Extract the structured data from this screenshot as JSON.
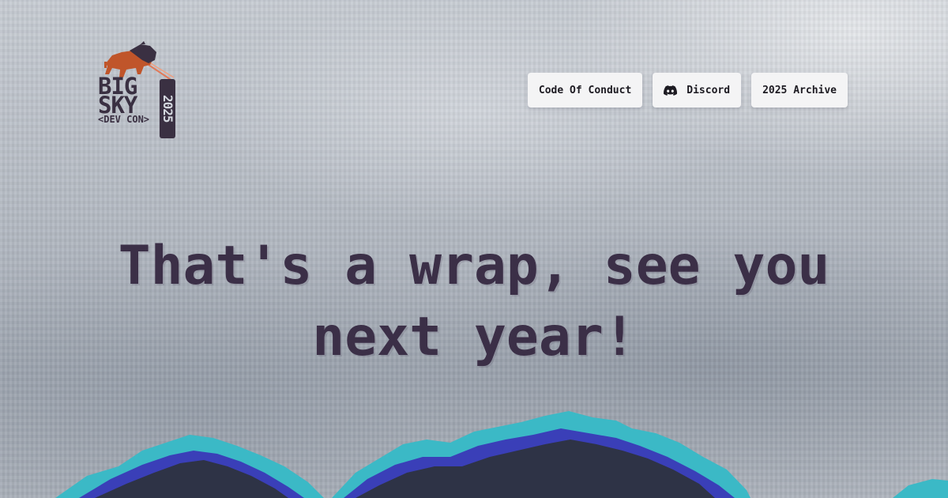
{
  "logo": {
    "line1": "BIG",
    "line2": "SKY",
    "tagline": "<DEV CON>",
    "year": "2025",
    "icon": "bison-icon"
  },
  "nav": {
    "code_of_conduct": "Code Of Conduct",
    "discord": "Discord",
    "archive": "2025 Archive"
  },
  "hero": {
    "headline": "That's a wrap, see you next year!"
  },
  "colors": {
    "headline": "#3b2f47",
    "mountain_teal": "#3bb9c6",
    "mountain_blue": "#3a3fb8",
    "mountain_dark": "#2e3346",
    "bison": "#c0552a"
  }
}
